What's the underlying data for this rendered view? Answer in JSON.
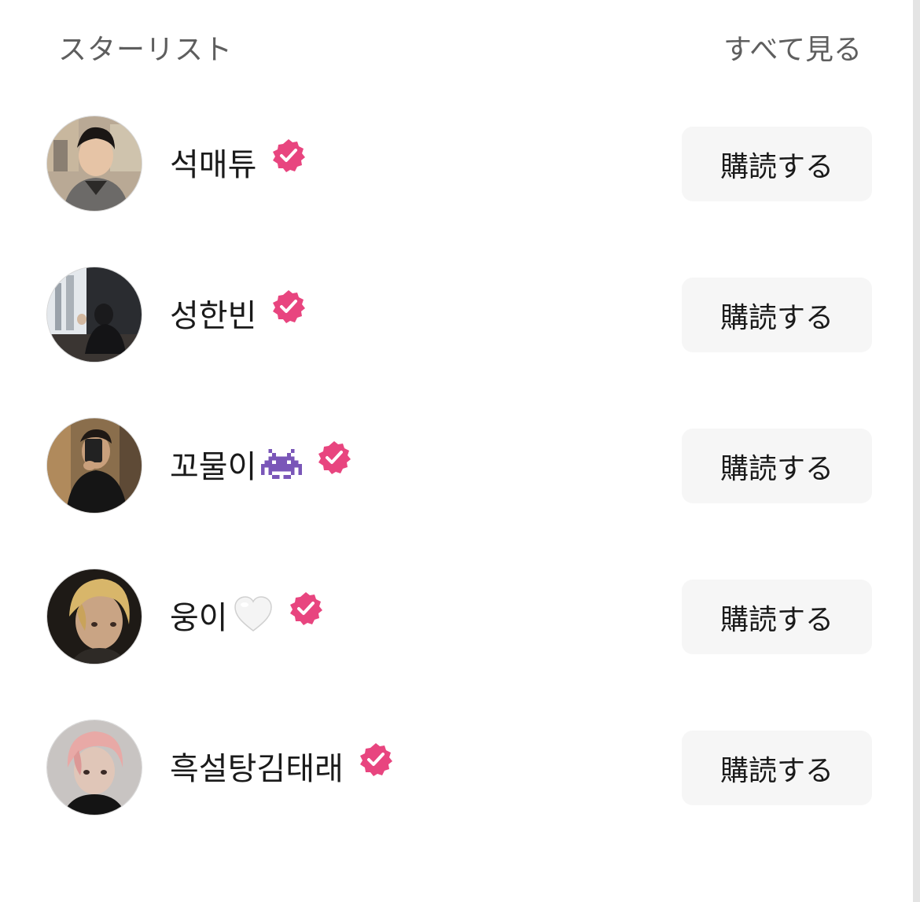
{
  "header": {
    "title": "スターリスト",
    "see_all": "すべて見る"
  },
  "stars": [
    {
      "name": "석매튜",
      "emoji": "",
      "verified": true,
      "button": "購読する"
    },
    {
      "name": "성한빈",
      "emoji": "",
      "verified": true,
      "button": "購読する"
    },
    {
      "name": "꼬물이",
      "emoji": "alien-monster-emoji",
      "verified": true,
      "button": "購読する"
    },
    {
      "name": "웅이",
      "emoji": "white-heart-emoji",
      "verified": true,
      "button": "購読する"
    },
    {
      "name": "흑설탕김태래",
      "emoji": "",
      "verified": true,
      "button": "購読する"
    }
  ],
  "colors": {
    "verified_badge": "#e8457f",
    "button_bg": "#f6f6f6",
    "header_text": "#5e5e5e",
    "name_text": "#1a1a1a"
  },
  "icons": {
    "verified": "verified-check-icon"
  }
}
